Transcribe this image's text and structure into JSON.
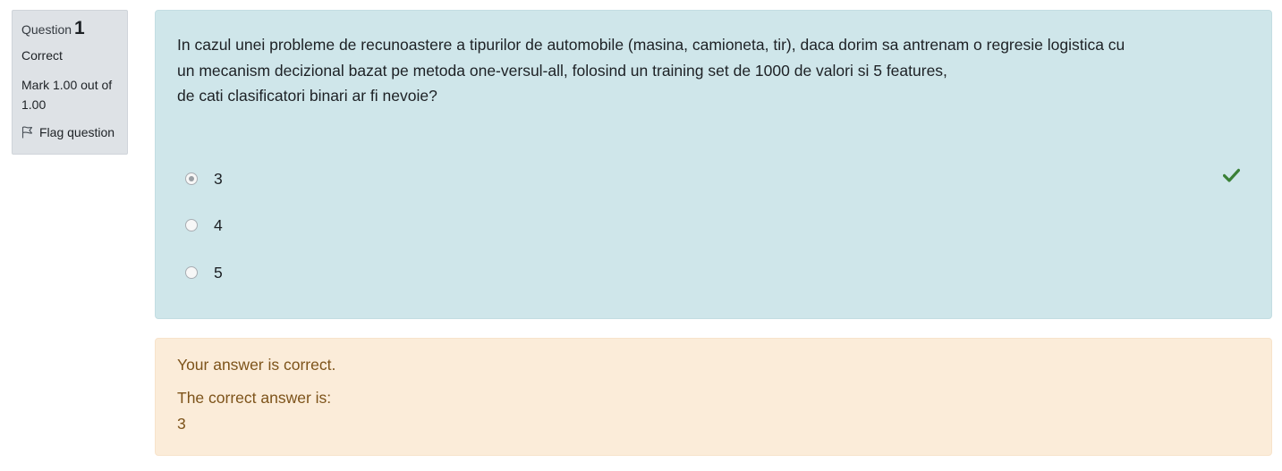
{
  "info": {
    "question_label": "Question",
    "question_number": "1",
    "state": "Correct",
    "grade": "Mark 1.00 out of 1.00",
    "flag_label": "Flag question",
    "flag_icon": "flag-outline-icon"
  },
  "question": {
    "text_lines": [
      "In cazul unei probleme de recunoastere a tipurilor de automobile (masina, camioneta, tir), daca dorim sa antrenam o regresie logistica cu",
      "un mecanism decizional bazat pe metoda one-versul-all, folosind un training set de 1000 de valori si 5 features,",
      "de cati clasificatori binari ar fi nevoie?"
    ],
    "answers": [
      {
        "label": "3",
        "selected": true
      },
      {
        "label": "4",
        "selected": false
      },
      {
        "label": "5",
        "selected": false
      }
    ],
    "result_icon": "checkmark-icon"
  },
  "outcome": {
    "feedback": "Your answer is correct.",
    "right_answer_label": "The correct answer is:",
    "right_answer_value": "3"
  },
  "colors": {
    "formulation_bg": "#cfe6ea",
    "outcome_bg": "#fbecd9",
    "outcome_text": "#7d531a",
    "info_bg": "#dee2e6",
    "check": "#3a8036"
  }
}
